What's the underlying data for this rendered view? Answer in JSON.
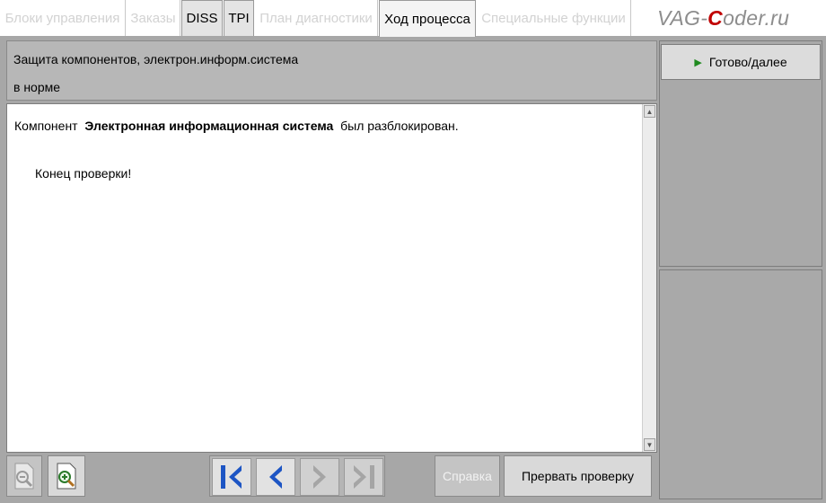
{
  "tabs": [
    {
      "label": "Блоки управления",
      "state": "disabled"
    },
    {
      "label": "Заказы",
      "state": "disabled"
    },
    {
      "label": "DISS",
      "state": "enabled"
    },
    {
      "label": "TPI",
      "state": "enabled"
    },
    {
      "label": "План диагностики",
      "state": "disabled"
    },
    {
      "label": "Ход процесса",
      "state": "selected"
    },
    {
      "label": "Специальные функции",
      "state": "disabled"
    }
  ],
  "logo": {
    "prefix": "VAG-",
    "accent": "C",
    "suffix": "oder.ru"
  },
  "header": {
    "title": "Защита компонентов, электрон.информ.система",
    "status": "в норме"
  },
  "content": {
    "msg_prefix": "Компонент ",
    "msg_bold": "Электронная информационная система",
    "msg_suffix": " был разблокирован.",
    "end": "Конец проверки!"
  },
  "right_panel": {
    "ready_label": "Готово/далее"
  },
  "toolbar": {
    "help_label": "Справка",
    "abort_label": "Прервать проверку"
  },
  "icons": {
    "zoom_out": "zoom-out-icon",
    "zoom_in": "zoom-in-icon",
    "first": "skip-to-start-icon",
    "back": "back-icon",
    "forward": "forward-icon",
    "last": "skip-to-end-icon"
  },
  "colors": {
    "accent_green": "#1f8a1f",
    "nav_blue": "#1d55c4",
    "logo_red": "#c00000"
  }
}
